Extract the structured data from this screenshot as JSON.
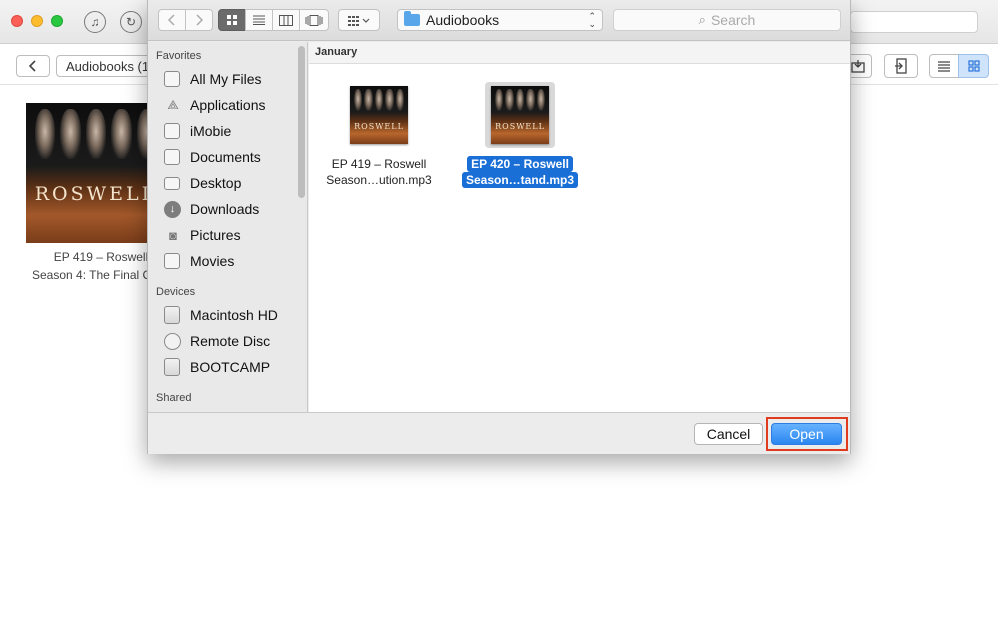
{
  "app": {
    "breadcrumb": "Audiobooks (1",
    "background_item": {
      "name_line1": "EP 419 – Roswell",
      "name_line2": "Season 4: The Final C",
      "cover_title": "ROSWELL"
    }
  },
  "dialog": {
    "path": "Audiobooks",
    "search_placeholder": "Search",
    "sidebar": {
      "favorites_header": "Favorites",
      "favorites": [
        {
          "label": "All My Files",
          "icon": "all-files-icon"
        },
        {
          "label": "Applications",
          "icon": "applications-icon"
        },
        {
          "label": "iMobie",
          "icon": "folder-icon"
        },
        {
          "label": "Documents",
          "icon": "documents-icon"
        },
        {
          "label": "Desktop",
          "icon": "desktop-icon"
        },
        {
          "label": "Downloads",
          "icon": "downloads-icon"
        },
        {
          "label": "Pictures",
          "icon": "camera-icon"
        },
        {
          "label": "Movies",
          "icon": "film-icon"
        }
      ],
      "devices_header": "Devices",
      "devices": [
        {
          "label": "Macintosh HD",
          "icon": "hard-disk-icon"
        },
        {
          "label": "Remote Disc",
          "icon": "disc-icon"
        },
        {
          "label": "BOOTCAMP",
          "icon": "hard-disk-icon"
        }
      ],
      "shared_header": "Shared"
    },
    "group_header": "January",
    "files": [
      {
        "line1": "EP 419 – Roswell",
        "line2": "Season…ution.mp3",
        "cover_title": "ROSWELL",
        "selected": false
      },
      {
        "line1": "EP 420 – Roswell",
        "line2": "Season…tand.mp3",
        "cover_title": "ROSWELL",
        "selected": true
      }
    ],
    "buttons": {
      "cancel": "Cancel",
      "open": "Open"
    },
    "colors": {
      "accent": "#2b86f0",
      "selection": "#1a6fd6",
      "highlight_box": "#e03a1f"
    }
  }
}
